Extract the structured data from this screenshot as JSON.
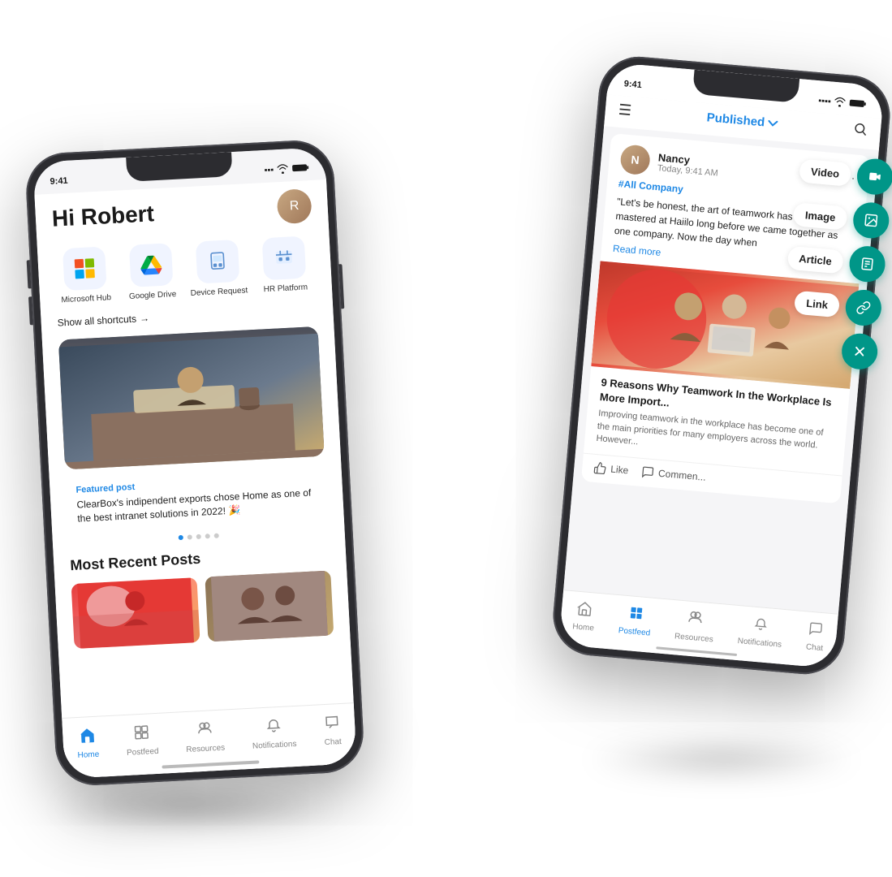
{
  "left_phone": {
    "status": {
      "time": "9:41",
      "signal": "●●●●",
      "wifi": "wifi",
      "battery": "battery"
    },
    "greeting": "Hi Robert",
    "shortcuts": [
      {
        "label": "Microsoft Hub",
        "icon": "microsoft"
      },
      {
        "label": "Google Drive",
        "icon": "drive"
      },
      {
        "label": "Device Request",
        "icon": "device"
      },
      {
        "label": "HR Platform",
        "icon": "hr"
      }
    ],
    "show_shortcuts": "Show all shortcuts",
    "featured_label": "Featured post",
    "featured_desc": "ClearBox's indipendent exports chose Home as one of the best intranet solutions in 2022! 🎉",
    "section_title": "Most Recent Posts",
    "nav": [
      {
        "label": "Home",
        "active": true
      },
      {
        "label": "Postfeed",
        "active": false
      },
      {
        "label": "Resources",
        "active": false
      },
      {
        "label": "Notifications",
        "active": false
      },
      {
        "label": "Chat",
        "active": false
      }
    ]
  },
  "right_phone": {
    "status": {
      "time": "9:41"
    },
    "header": {
      "published": "Published",
      "menu": "☰",
      "search": "🔍"
    },
    "post": {
      "author": "Nancy",
      "time": "Today, 9:41 AM",
      "tag": "#All Company",
      "text": "\"Let's be honest, the art of teamwork has been mastered at Haiilo long before we came together as one company. Now the day when",
      "read_more": "Read more"
    },
    "article": {
      "title": "9 Reasons Why Teamwork In the Workplace Is More Import...",
      "desc": "Improving teamwork in the workplace has become one of the main priorities for many employers across the world. However..."
    },
    "actions": {
      "like": "Like",
      "comment": "Commen..."
    },
    "fab_buttons": [
      {
        "label": "Video",
        "icon": "📹"
      },
      {
        "label": "Image",
        "icon": "🖼"
      },
      {
        "label": "Article",
        "icon": "📄"
      },
      {
        "label": "Link",
        "icon": "🔗"
      }
    ],
    "nav": [
      {
        "label": "Home",
        "active": false
      },
      {
        "label": "Postfeed",
        "active": true
      },
      {
        "label": "Resources",
        "active": false
      },
      {
        "label": "Notifications",
        "active": false
      },
      {
        "label": "Chat",
        "active": false
      }
    ]
  }
}
